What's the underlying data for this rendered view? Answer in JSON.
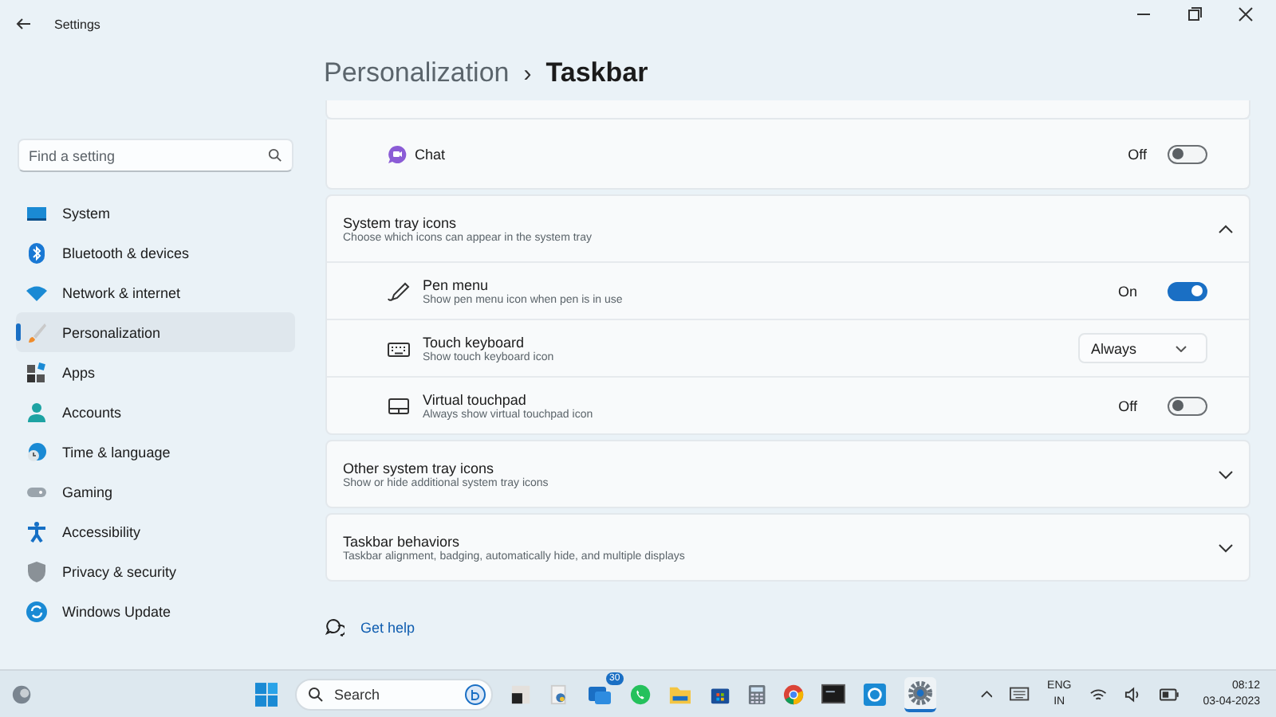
{
  "window": {
    "title": "Settings"
  },
  "search": {
    "placeholder": "Find a setting"
  },
  "sidebar": {
    "items": [
      {
        "label": "System",
        "selected": false
      },
      {
        "label": "Bluetooth & devices",
        "selected": false
      },
      {
        "label": "Network & internet",
        "selected": false
      },
      {
        "label": "Personalization",
        "selected": true
      },
      {
        "label": "Apps",
        "selected": false
      },
      {
        "label": "Accounts",
        "selected": false
      },
      {
        "label": "Time & language",
        "selected": false
      },
      {
        "label": "Gaming",
        "selected": false
      },
      {
        "label": "Accessibility",
        "selected": false
      },
      {
        "label": "Privacy & security",
        "selected": false
      },
      {
        "label": "Windows Update",
        "selected": false
      }
    ]
  },
  "breadcrumb": {
    "parent": "Personalization",
    "separator": "›",
    "current": "Taskbar"
  },
  "chat_row": {
    "label": "Chat",
    "state_text": "Off",
    "on": false
  },
  "sections": [
    {
      "title": "System tray icons",
      "subtitle": "Choose which icons can appear in the system tray",
      "expanded": true,
      "rows": [
        {
          "kind": "toggle",
          "title": "Pen menu",
          "subtitle": "Show pen menu icon when pen is in use",
          "state_text": "On",
          "on": true
        },
        {
          "kind": "dropdown",
          "title": "Touch keyboard",
          "subtitle": "Show touch keyboard icon",
          "value": "Always"
        },
        {
          "kind": "toggle",
          "title": "Virtual touchpad",
          "subtitle": "Always show virtual touchpad icon",
          "state_text": "Off",
          "on": false
        }
      ]
    },
    {
      "title": "Other system tray icons",
      "subtitle": "Show or hide additional system tray icons",
      "expanded": false
    },
    {
      "title": "Taskbar behaviors",
      "subtitle": "Taskbar alignment, badging, automatically hide, and multiple displays",
      "expanded": false
    }
  ],
  "help_link": "Get help",
  "taskbar": {
    "search_placeholder": "Search",
    "badge": "30",
    "language": "ENG",
    "region": "IN",
    "time": "08:12",
    "date": "03-04-2023"
  }
}
